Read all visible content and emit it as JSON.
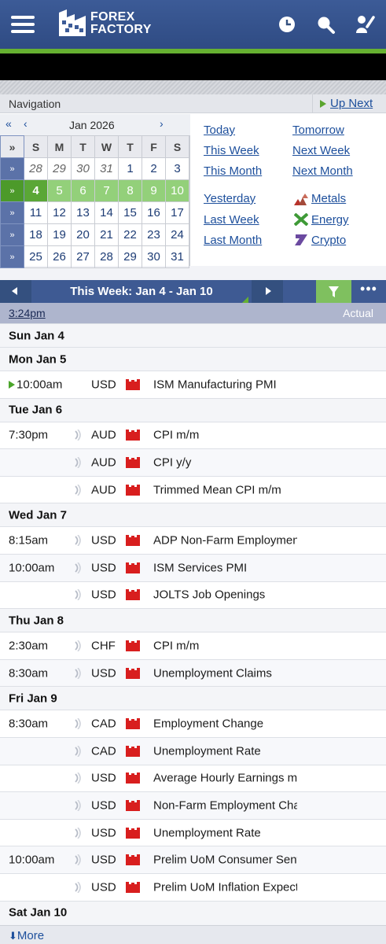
{
  "header": {
    "logo_line1": "FOREX",
    "logo_line2": "FACTORY"
  },
  "navigation": {
    "title": "Navigation",
    "up_next": "Up Next",
    "month": "Jan 2026",
    "weekday_headers": [
      "S",
      "M",
      "T",
      "W",
      "T",
      "F",
      "S"
    ],
    "weeks": [
      {
        "days": [
          "28",
          "29",
          "30",
          "31",
          "1",
          "2",
          "3"
        ],
        "prev_count": 4
      },
      {
        "days": [
          "4",
          "5",
          "6",
          "7",
          "8",
          "9",
          "10"
        ],
        "current": true,
        "today_index": 0
      },
      {
        "days": [
          "11",
          "12",
          "13",
          "14",
          "15",
          "16",
          "17"
        ]
      },
      {
        "days": [
          "18",
          "19",
          "20",
          "21",
          "22",
          "23",
          "24"
        ]
      },
      {
        "days": [
          "25",
          "26",
          "27",
          "28",
          "29",
          "30",
          "31"
        ]
      }
    ],
    "quick_links": {
      "today": "Today",
      "tomorrow": "Tomorrow",
      "this_week": "This Week",
      "next_week": "Next Week",
      "this_month": "This Month",
      "next_month": "Next Month",
      "yesterday": "Yesterday",
      "metals": "Metals",
      "last_week": "Last Week",
      "energy": "Energy",
      "last_month": "Last Month",
      "crypto": "Crypto"
    }
  },
  "calendar": {
    "week_title": "This Week: Jan 4 - Jan 10",
    "time_link": "3:24pm",
    "actual_label": "Actual",
    "days": [
      {
        "label": "Sun Jan 4",
        "events": []
      },
      {
        "label": "Mon Jan 5",
        "events": [
          {
            "time": "10:00am",
            "currency": "USD",
            "name": "ISM Manufacturing PMI",
            "upnext": true
          }
        ]
      },
      {
        "label": "Tue Jan 6",
        "events": [
          {
            "time": "7:30pm",
            "currency": "AUD",
            "name": "CPI m/m"
          },
          {
            "time": "",
            "currency": "AUD",
            "name": "CPI y/y"
          },
          {
            "time": "",
            "currency": "AUD",
            "name": "Trimmed Mean CPI m/m"
          }
        ]
      },
      {
        "label": "Wed Jan 7",
        "events": [
          {
            "time": "8:15am",
            "currency": "USD",
            "name": "ADP Non-Farm Employment Change"
          },
          {
            "time": "10:00am",
            "currency": "USD",
            "name": "ISM Services PMI"
          },
          {
            "time": "",
            "currency": "USD",
            "name": "JOLTS Job Openings"
          }
        ]
      },
      {
        "label": "Thu Jan 8",
        "events": [
          {
            "time": "2:30am",
            "currency": "CHF",
            "name": "CPI m/m"
          },
          {
            "time": "8:30am",
            "currency": "USD",
            "name": "Unemployment Claims"
          }
        ]
      },
      {
        "label": "Fri Jan 9",
        "events": [
          {
            "time": "8:30am",
            "currency": "CAD",
            "name": "Employment Change"
          },
          {
            "time": "",
            "currency": "CAD",
            "name": "Unemployment Rate"
          },
          {
            "time": "",
            "currency": "USD",
            "name": "Average Hourly Earnings m/m"
          },
          {
            "time": "",
            "currency": "USD",
            "name": "Non-Farm Employment Change"
          },
          {
            "time": "",
            "currency": "USD",
            "name": "Unemployment Rate"
          },
          {
            "time": "10:00am",
            "currency": "USD",
            "name": "Prelim UoM Consumer Sentiment"
          },
          {
            "time": "",
            "currency": "USD",
            "name": "Prelim UoM Inflation Expectations"
          }
        ]
      },
      {
        "label": "Sat Jan 10",
        "events": []
      }
    ],
    "more_label": "More"
  },
  "colors": {
    "header": "#3c5b97",
    "accent_green": "#66b131",
    "impact_high": "#d81e1e",
    "link": "#1d4f9c"
  }
}
